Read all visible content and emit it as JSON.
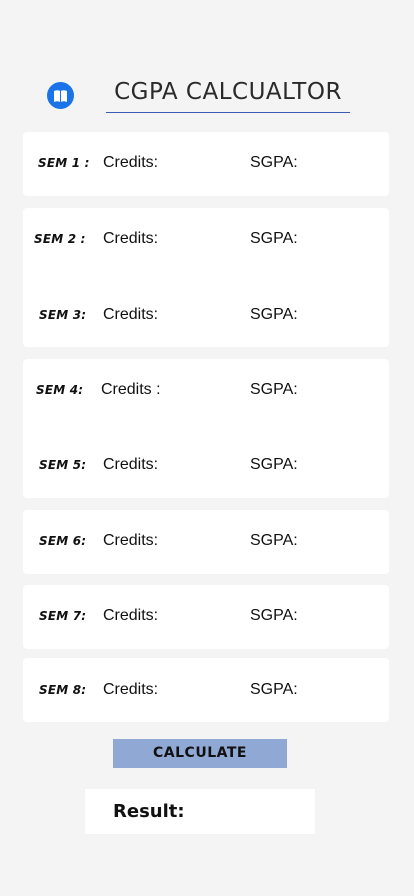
{
  "header": {
    "title": "CGPA CALCUALTOR",
    "icon": "book-icon",
    "icon_color": "#1a73e8"
  },
  "semesters": [
    {
      "label": "SEM 1 :",
      "credits_label": "Credits:",
      "sgpa_label": "SGPA:"
    },
    {
      "label": "SEM 2 :",
      "credits_label": "Credits:",
      "sgpa_label": "SGPA:"
    },
    {
      "label": "SEM 3:",
      "credits_label": "Credits:",
      "sgpa_label": "SGPA:"
    },
    {
      "label": "SEM 4:",
      "credits_label": "Credits :",
      "sgpa_label": "SGPA:"
    },
    {
      "label": "SEM 5:",
      "credits_label": "Credits:",
      "sgpa_label": "SGPA:"
    },
    {
      "label": "SEM 6:",
      "credits_label": "Credits:",
      "sgpa_label": "SGPA:"
    },
    {
      "label": "SEM 7:",
      "credits_label": "Credits:",
      "sgpa_label": "SGPA:"
    },
    {
      "label": "SEM 8:",
      "credits_label": "Credits:",
      "sgpa_label": "SGPA:"
    }
  ],
  "calculate_button": {
    "label": "CALCULATE",
    "color": "#8fa8d4"
  },
  "result": {
    "label": "Result:"
  }
}
